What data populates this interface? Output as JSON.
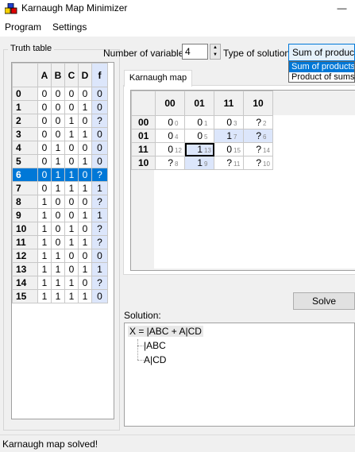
{
  "window": {
    "title": "Karnaugh Map Minimizer",
    "minimize_glyph": "—"
  },
  "menu": [
    "Program",
    "Settings"
  ],
  "truth_table": {
    "legend": "Truth table",
    "headers": [
      "A",
      "B",
      "C",
      "D",
      "f"
    ],
    "rows": [
      {
        "idx": "0",
        "bits": [
          "0",
          "0",
          "0",
          "0"
        ],
        "f": "0"
      },
      {
        "idx": "1",
        "bits": [
          "0",
          "0",
          "0",
          "1"
        ],
        "f": "0"
      },
      {
        "idx": "2",
        "bits": [
          "0",
          "0",
          "1",
          "0"
        ],
        "f": "?"
      },
      {
        "idx": "3",
        "bits": [
          "0",
          "0",
          "1",
          "1"
        ],
        "f": "0"
      },
      {
        "idx": "4",
        "bits": [
          "0",
          "1",
          "0",
          "0"
        ],
        "f": "0"
      },
      {
        "idx": "5",
        "bits": [
          "0",
          "1",
          "0",
          "1"
        ],
        "f": "0"
      },
      {
        "idx": "6",
        "bits": [
          "0",
          "1",
          "1",
          "0"
        ],
        "f": "?"
      },
      {
        "idx": "7",
        "bits": [
          "0",
          "1",
          "1",
          "1"
        ],
        "f": "1"
      },
      {
        "idx": "8",
        "bits": [
          "1",
          "0",
          "0",
          "0"
        ],
        "f": "?"
      },
      {
        "idx": "9",
        "bits": [
          "1",
          "0",
          "0",
          "1"
        ],
        "f": "1"
      },
      {
        "idx": "10",
        "bits": [
          "1",
          "0",
          "1",
          "0"
        ],
        "f": "?"
      },
      {
        "idx": "11",
        "bits": [
          "1",
          "0",
          "1",
          "1"
        ],
        "f": "?"
      },
      {
        "idx": "12",
        "bits": [
          "1",
          "1",
          "0",
          "0"
        ],
        "f": "0"
      },
      {
        "idx": "13",
        "bits": [
          "1",
          "1",
          "0",
          "1"
        ],
        "f": "1"
      },
      {
        "idx": "14",
        "bits": [
          "1",
          "1",
          "1",
          "0"
        ],
        "f": "?"
      },
      {
        "idx": "15",
        "bits": [
          "1",
          "1",
          "1",
          "1"
        ],
        "f": "0"
      }
    ],
    "selected_row": 6
  },
  "controls": {
    "num_vars_label": "Number of variables:",
    "num_vars_value": "4",
    "solution_type_label": "Type of solution:",
    "solution_type_selected": "Sum of products",
    "solution_type_options": [
      "Sum of products",
      "Product of sums"
    ]
  },
  "kmap": {
    "tab_label": "Karnaugh map",
    "col_headers": [
      "10",
      "00",
      "01",
      "11"
    ],
    "row_headers": [
      "00",
      "01",
      "11",
      "10"
    ],
    "cells": [
      [
        {
          "v": "0",
          "i": "0"
        },
        {
          "v": "0",
          "i": "1"
        },
        {
          "v": "0",
          "i": "3"
        },
        {
          "v": "?",
          "i": "2"
        }
      ],
      [
        {
          "v": "0",
          "i": "4"
        },
        {
          "v": "0",
          "i": "5"
        },
        {
          "v": "1",
          "i": "7",
          "hl": true
        },
        {
          "v": "?",
          "i": "6",
          "hl": true
        }
      ],
      [
        {
          "v": "0",
          "i": "12"
        },
        {
          "v": "1",
          "i": "13",
          "hl": true,
          "focus": true
        },
        {
          "v": "0",
          "i": "15"
        },
        {
          "v": "?",
          "i": "14"
        }
      ],
      [
        {
          "v": "?",
          "i": "8"
        },
        {
          "v": "1",
          "i": "9",
          "hl": true
        },
        {
          "v": "?",
          "i": "11"
        },
        {
          "v": "?",
          "i": "10"
        }
      ]
    ]
  },
  "solve_label": "Solve",
  "solution": {
    "caption": "Solution:",
    "expression": "X = |ABC + A|CD",
    "terms": [
      "|ABC",
      "A|CD"
    ]
  },
  "status": "Karnaugh map solved!",
  "colors": {
    "selection": "#0078d7",
    "highlight": "#dce6fb"
  }
}
